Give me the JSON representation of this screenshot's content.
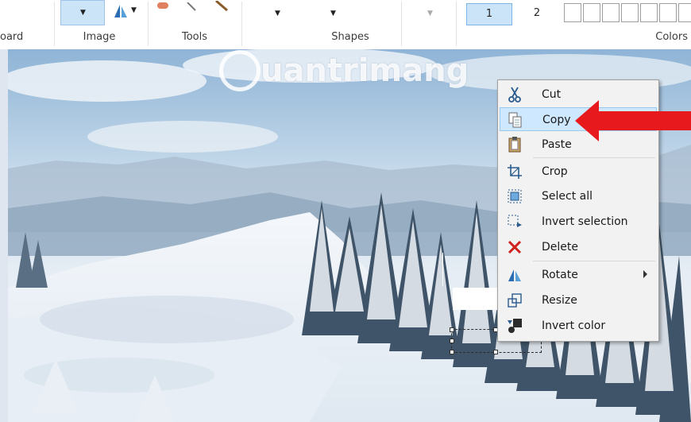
{
  "ribbon": {
    "groups": {
      "clipboard": "oard",
      "image": "Image",
      "tools": "Tools",
      "shapes": "Shapes",
      "colors": "Colors"
    },
    "size_options": [
      "1",
      "2"
    ],
    "selected_size": "1"
  },
  "watermark": {
    "text": "uantrimang"
  },
  "context_menu": {
    "items": [
      {
        "label": "Cut",
        "icon": "scissors-icon"
      },
      {
        "label": "Copy",
        "icon": "copy-icon",
        "highlighted": true
      },
      {
        "label": "Paste",
        "icon": "clipboard-icon"
      },
      {
        "label": "Crop",
        "icon": "crop-icon"
      },
      {
        "label": "Select all",
        "icon": "select-all-icon"
      },
      {
        "label": "Invert selection",
        "icon": "invert-selection-icon"
      },
      {
        "label": "Delete",
        "icon": "delete-x-icon"
      },
      {
        "label": "Rotate",
        "icon": "rotate-icon",
        "submenu": true
      },
      {
        "label": "Resize",
        "icon": "resize-icon"
      },
      {
        "label": "Invert color",
        "icon": "invert-color-icon"
      }
    ]
  },
  "colors": {
    "accent": "#cce4f7",
    "menu_highlight": "#cde8ff",
    "arrow": "#e8191c"
  }
}
